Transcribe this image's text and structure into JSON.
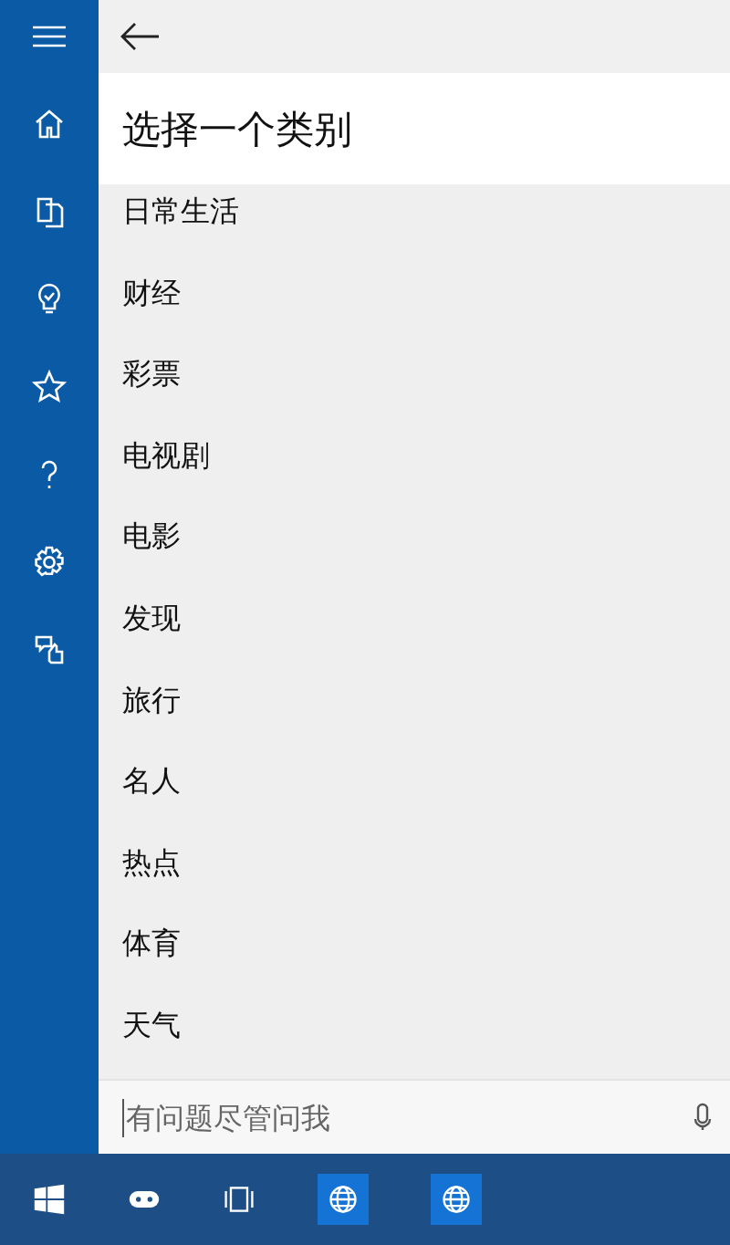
{
  "sidebar": {
    "items": [
      {
        "kind": "menu"
      },
      {
        "kind": "home"
      },
      {
        "kind": "notebook"
      },
      {
        "kind": "bulb"
      },
      {
        "kind": "star"
      },
      {
        "kind": "help"
      },
      {
        "kind": "settings"
      },
      {
        "kind": "feedback"
      }
    ]
  },
  "header": {
    "title": "选择一个类别"
  },
  "categories": [
    "日常生活",
    "财经",
    "彩票",
    "电视剧",
    "电影",
    "发现",
    "旅行",
    "名人",
    "热点",
    "体育",
    "天气"
  ],
  "search": {
    "placeholder": "有问题尽管问我"
  },
  "taskbar": {
    "items": [
      {
        "kind": "start"
      },
      {
        "kind": "cortana"
      },
      {
        "kind": "taskview"
      },
      {
        "kind": "globe"
      },
      {
        "kind": "globe"
      }
    ]
  }
}
